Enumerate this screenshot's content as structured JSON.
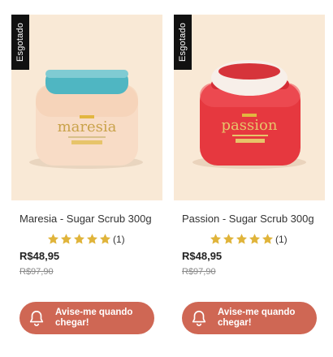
{
  "products": [
    {
      "badge": "Esgotado",
      "title": "Maresia - Sugar Scrub 300g",
      "jar_label": "maresia",
      "rating_count": "(1)",
      "rating": 5,
      "price": "R$48,95",
      "old_price": "R$97,90",
      "button_label": "Avise-me quando chegar!",
      "colors": {
        "jar": "#f8dcc6",
        "lid": "#4fb6c2",
        "label": "#c9a24a"
      }
    },
    {
      "badge": "Esgotado",
      "title": "Passion - Sugar Scrub 300g",
      "jar_label": "passion",
      "rating_count": "(1)",
      "rating": 5,
      "price": "R$48,95",
      "old_price": "R$97,90",
      "button_label": "Avise-me quando chegar!",
      "colors": {
        "jar": "#e6383f",
        "lid": "#f7efe9",
        "label": "#e7c46a"
      }
    }
  ],
  "colors": {
    "background_tile": "#f9e9d6",
    "button": "#cf6754",
    "star": "#e0b43a"
  }
}
